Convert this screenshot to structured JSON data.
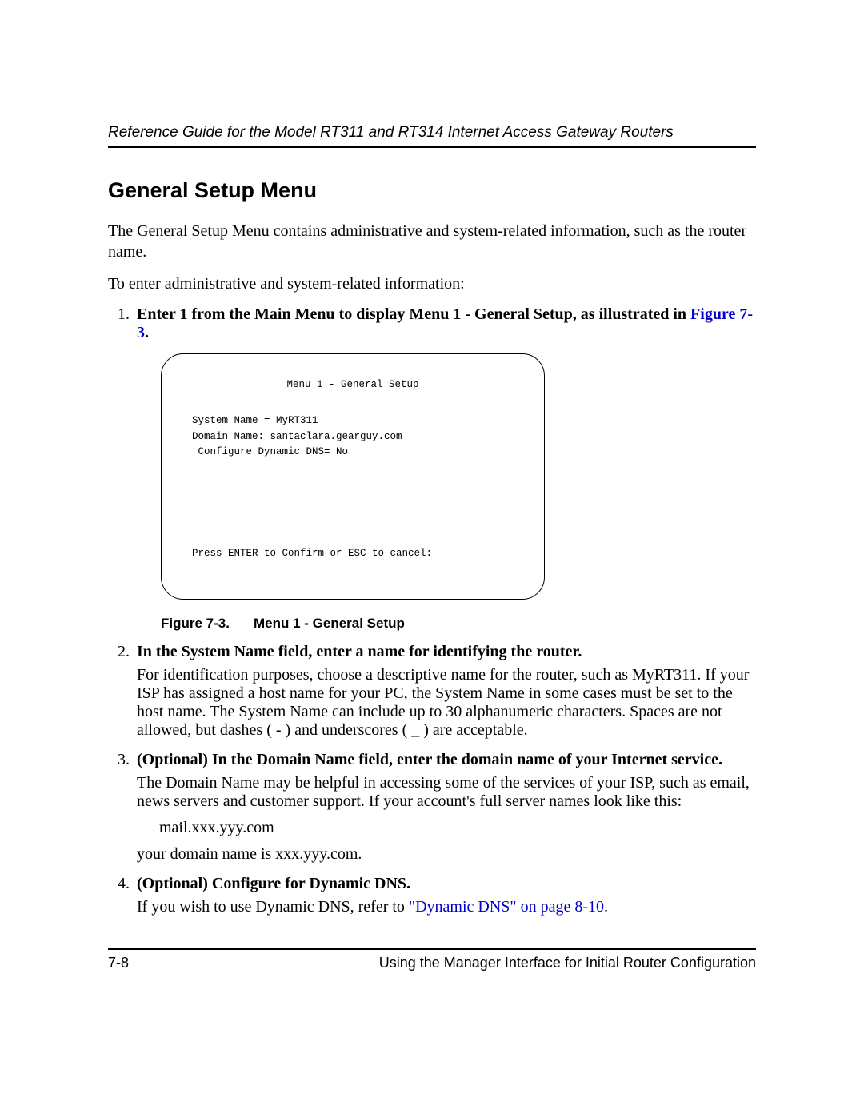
{
  "header": {
    "running": "Reference Guide for the Model RT311 and RT314 Internet Access Gateway Routers"
  },
  "section": {
    "title": "General Setup Menu",
    "intro1": "The General Setup Menu contains administrative and system-related information, such as the router name.",
    "intro2": "To enter administrative and system-related information:"
  },
  "steps": {
    "s1": {
      "lead": "Enter 1 from the Main Menu to display Menu 1 - General Setup, as illustrated in ",
      "figref": "Figure 7-3",
      "tail": "."
    },
    "s2": {
      "lead": "In the System Name field, enter a name for identifying the router.",
      "body": "For identification purposes, choose a descriptive name for the router, such as MyRT311. If your ISP has assigned a host name for your PC, the System Name in some cases must be set to the host name. The System Name can include up to 30 alphanumeric characters. Spaces are not allowed, but dashes ( - ) and underscores ( _ ) are acceptable."
    },
    "s3": {
      "lead": "(Optional) In the Domain Name field, enter the domain name of your Internet service.",
      "body1": "The Domain Name may be helpful in accessing some of the services of your ISP, such as email, news servers and customer support. If your account's full server names look like this:",
      "example": "mail.xxx.yyy.com",
      "body2": "your domain name is xxx.yyy.com."
    },
    "s4": {
      "lead": "(Optional) Configure for Dynamic DNS.",
      "body_pre": "If you wish to use Dynamic DNS, refer to ",
      "link": "\"Dynamic DNS\" on page 8-10",
      "body_post": "."
    }
  },
  "menu": {
    "title": "Menu 1 - General Setup",
    "system_name_label": "System Name = ",
    "system_name_value": "MyRT311",
    "domain_name_label": "Domain Name: ",
    "domain_name_value": "santaclara.gearguy.com",
    "dyn_dns_label": " Configure Dynamic DNS= ",
    "dyn_dns_value": "No",
    "prompt": "Press ENTER to Confirm or ESC to cancel:"
  },
  "figure": {
    "label": "Figure 7-3.",
    "caption": "Menu 1 - General Setup"
  },
  "footer": {
    "page": "7-8",
    "chapter": "Using the Manager Interface for Initial Router Configuration"
  }
}
